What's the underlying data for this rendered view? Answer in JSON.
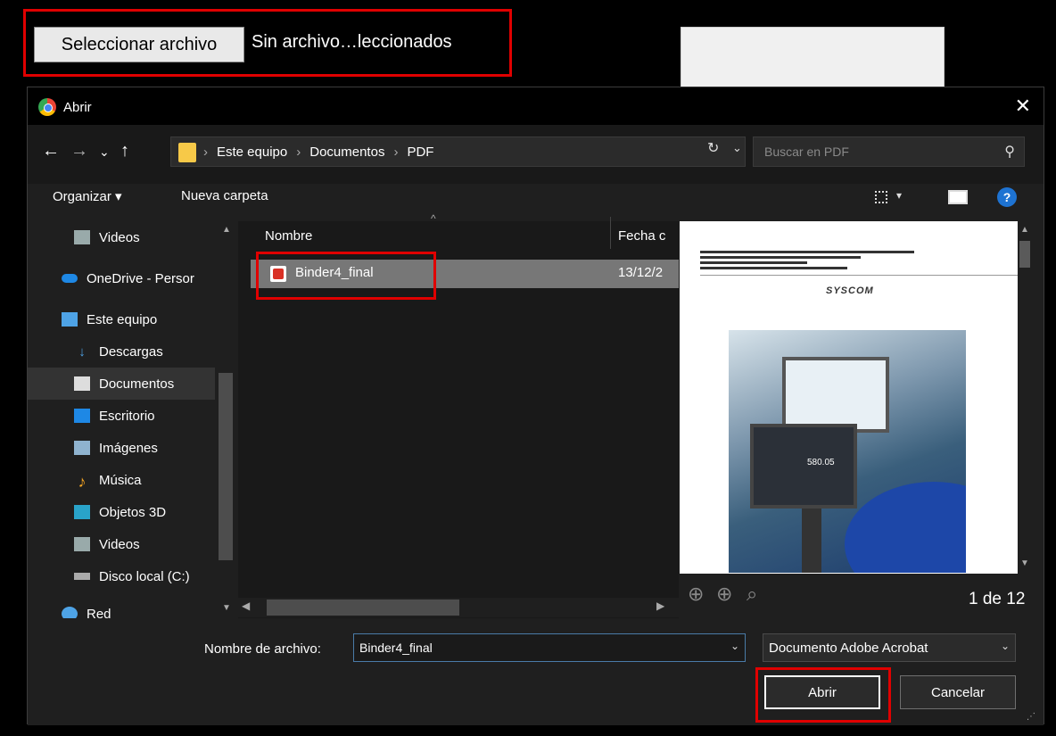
{
  "file_input": {
    "button_label": "Seleccionar archivo",
    "status_text": "Sin archivo…leccionados"
  },
  "dialog": {
    "title": "Abrir",
    "close": "✕",
    "nav": {
      "back": "←",
      "forward": "→",
      "recent": "⌄",
      "up": "↑"
    },
    "breadcrumb": [
      "Este equipo",
      "Documentos",
      "PDF"
    ],
    "breadcrumb_sep": "›",
    "search_placeholder": "Buscar en PDF",
    "toolbar": {
      "organize": "Organizar ▾",
      "new_folder": "Nueva carpeta",
      "help": "?"
    },
    "sidebar": [
      {
        "label": "Videos",
        "icon": "video-folder-icon"
      },
      {
        "label": "OneDrive - Persor",
        "icon": "onedrive-icon"
      },
      {
        "label": "Este equipo",
        "icon": "computer-icon"
      },
      {
        "label": "Descargas",
        "icon": "download-icon"
      },
      {
        "label": "Documentos",
        "icon": "documents-icon",
        "selected": true
      },
      {
        "label": "Escritorio",
        "icon": "desktop-icon"
      },
      {
        "label": "Imágenes",
        "icon": "pictures-icon"
      },
      {
        "label": "Música",
        "icon": "music-icon"
      },
      {
        "label": "Objetos 3D",
        "icon": "3d-objects-icon"
      },
      {
        "label": "Videos",
        "icon": "video-folder-icon"
      },
      {
        "label": "Disco local (C:)",
        "icon": "drive-icon"
      },
      {
        "label": "Red",
        "icon": "network-icon"
      }
    ],
    "columns": {
      "name": "Nombre",
      "date": "Fecha c"
    },
    "files": [
      {
        "name": "Binder4_final",
        "date": "13/12/2",
        "icon": "pdf-icon"
      }
    ],
    "preview": {
      "logo": "SYSCOM",
      "screen_value": "580.05",
      "page_indicator": "1 de 12"
    },
    "filename_label": "Nombre de archivo:",
    "filename_value": "Binder4_final",
    "filetype_value": "Documento Adobe Acrobat",
    "open_button": "Abrir",
    "cancel_button": "Cancelar"
  },
  "colors": {
    "highlight": "#e00000",
    "background": "#1f1f1f",
    "selected_row": "#777777"
  }
}
